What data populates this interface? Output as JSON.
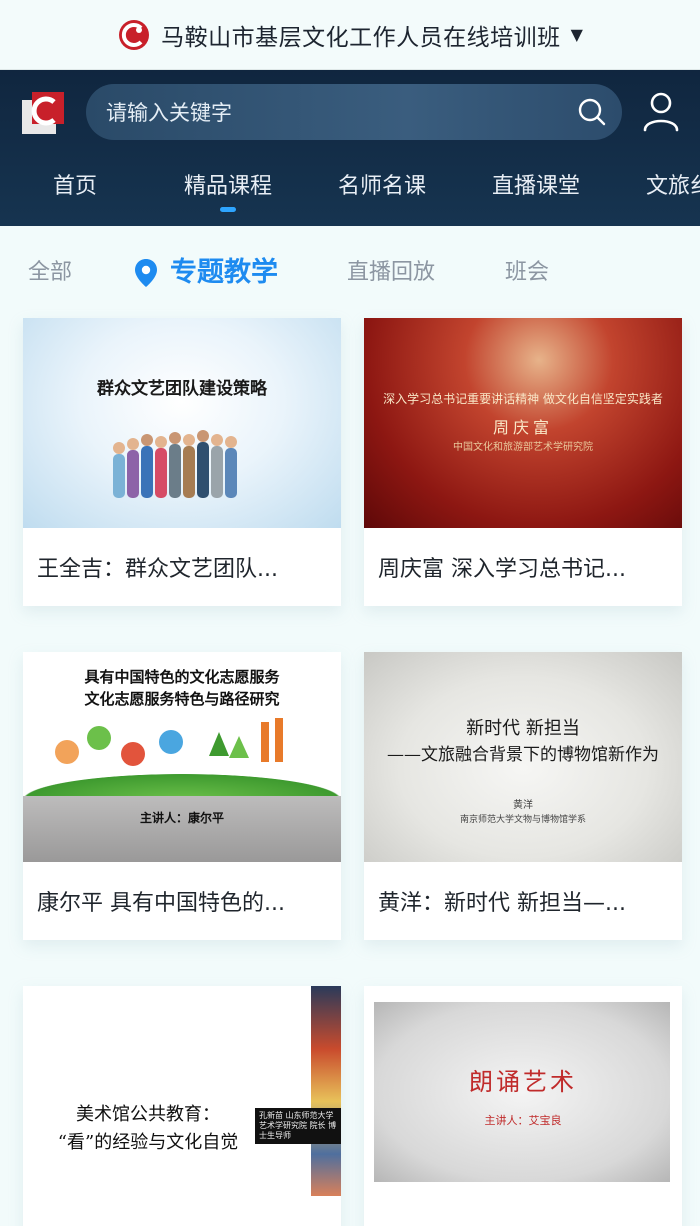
{
  "titlebar": {
    "title": "马鞍山市基层文化工作人员在线培训班",
    "caret": "▼"
  },
  "header": {
    "search_placeholder": "请输入关键字",
    "nav_tabs": [
      {
        "label": "首页"
      },
      {
        "label": "精品课程"
      },
      {
        "label": "名师名课"
      },
      {
        "label": "直播课堂"
      },
      {
        "label": "文旅纟"
      }
    ],
    "active_tab": "精品课程"
  },
  "subtabs": [
    {
      "label": "全部"
    },
    {
      "label": "专题教学"
    },
    {
      "label": "直播回放"
    },
    {
      "label": "班会"
    }
  ],
  "active_subtab": "专题教学",
  "courses": [
    {
      "caption": "王全吉：群众文艺团队...",
      "thumb_text": [
        "群众文艺团队建设策略"
      ]
    },
    {
      "caption": "周庆富 深入学习总书记...",
      "thumb_text": [
        "深入学习总书记重要讲话精神 做文化自信坚定实践者",
        "周庆富",
        "中国文化和旅游部艺术学研究院"
      ]
    },
    {
      "caption": "康尔平 具有中国特色的...",
      "thumb_text": [
        "具有中国特色的文化志愿服务",
        "文化志愿服务特色与路径研究",
        "主讲人：康尔平"
      ]
    },
    {
      "caption": "黄洋：新时代 新担当—...",
      "thumb_text": [
        "新时代  新担当",
        "——文旅融合背景下的博物馆新作为",
        "黄洋",
        "南京师范大学文物与博物馆学系"
      ]
    },
    {
      "caption": "",
      "thumb_text": [
        "美术馆公共教育：",
        "“看”的经验与文化自觉",
        "孔新苗 山东师范大学艺术学研究院 院长 博士生导师"
      ]
    },
    {
      "caption": "",
      "thumb_text": [
        "朗诵艺术",
        "主讲人：艾宝良"
      ]
    }
  ],
  "colors": {
    "accent": "#1e8bf0",
    "header_bg": "#10263f",
    "brand_red": "#c8202a"
  }
}
